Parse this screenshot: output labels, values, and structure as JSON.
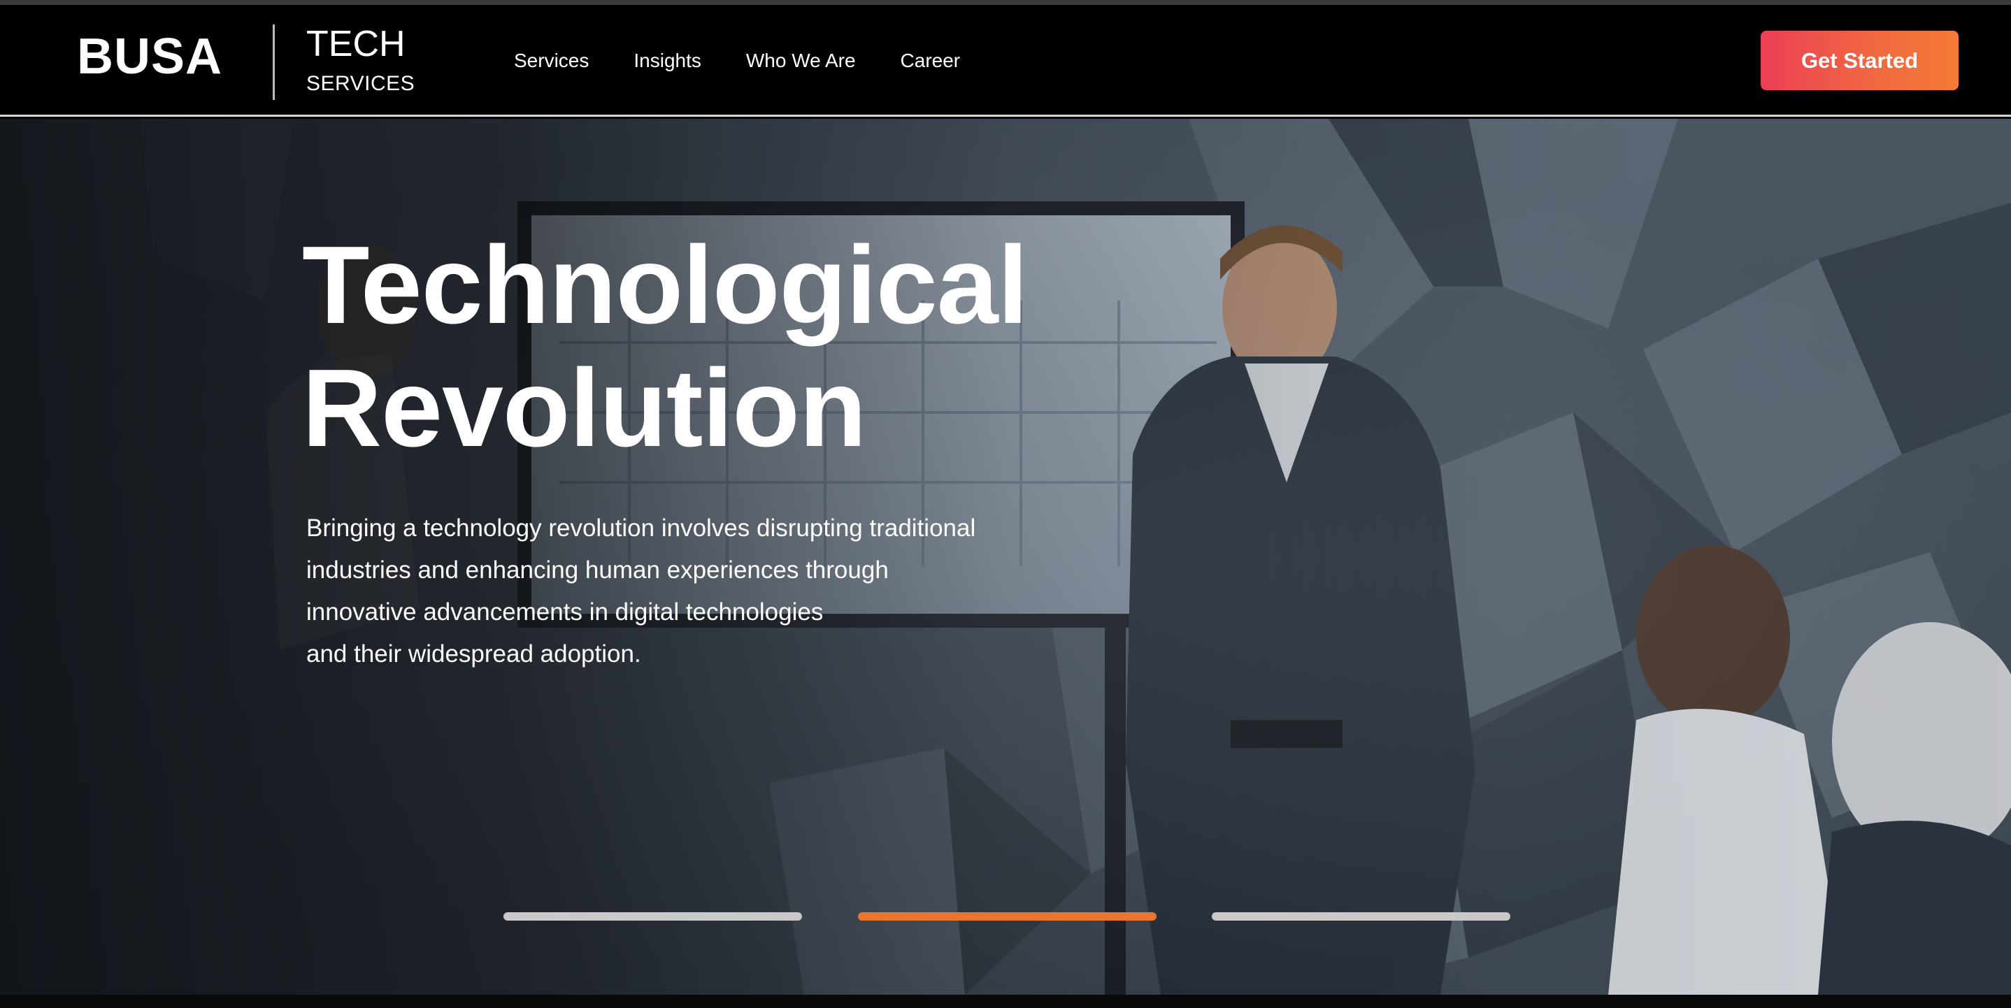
{
  "header": {
    "logo": "BUSA",
    "brand_line1": "TECH",
    "brand_line2": "SERVICES",
    "nav": [
      {
        "label": "Services"
      },
      {
        "label": "Insights"
      },
      {
        "label": "Who We Are"
      },
      {
        "label": "Career"
      }
    ],
    "cta_label": "Get Started"
  },
  "hero": {
    "title_line1": "Technological",
    "title_line2": "Revolution",
    "description_lines": [
      "Bringing a technology revolution involves disrupting traditional",
      "industries and enhancing human experiences through",
      "innovative advancements in digital technologies",
      "and their widespread adoption."
    ],
    "carousel": {
      "slide_count": 3,
      "active_index": 1
    }
  },
  "colors": {
    "accent_gradient_start": "#ec3f55",
    "accent_gradient_end": "#f47a35",
    "active_indicator": "#e9752f",
    "inactive_indicator": "#c9c9c9"
  }
}
